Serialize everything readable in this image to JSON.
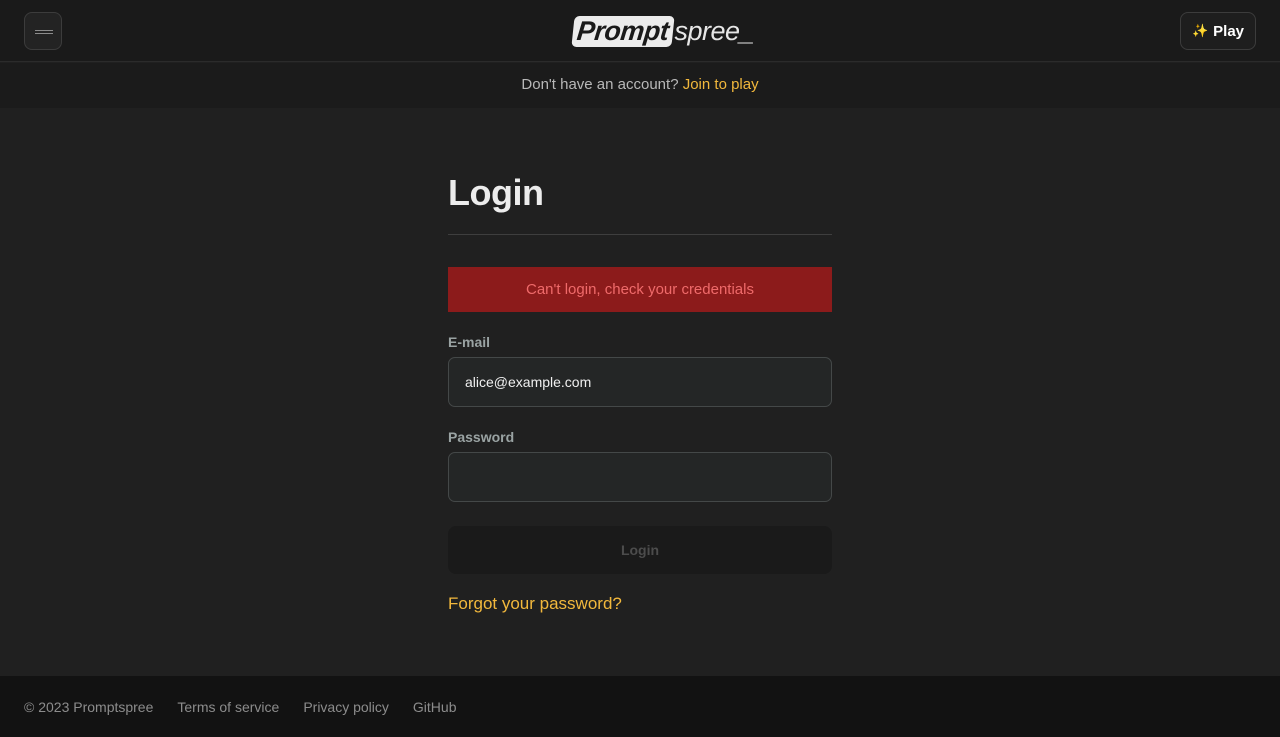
{
  "header": {
    "logo_prompt": "Prompt",
    "logo_rest": "spree_",
    "play_icon": "sparkles-icon",
    "play_label": "Play",
    "menu_icon": "hamburger-menu-icon"
  },
  "subbar": {
    "text": "Don't have an account?",
    "link": "Join to play"
  },
  "login": {
    "title": "Login",
    "error": "Can't login, check your credentials",
    "email_label": "E-mail",
    "email_value": "alice@example.com",
    "password_label": "Password",
    "password_value": "",
    "submit_label": "Login",
    "forgot_link": "Forgot your password?"
  },
  "footer": {
    "copyright": "© 2023 Promptspree",
    "links": [
      "Terms of service",
      "Privacy policy",
      "GitHub"
    ]
  },
  "colors": {
    "accent": "#f2b83c",
    "error_bg": "#8c1b1b",
    "error_text": "#ef6a6a",
    "background": "#202020"
  }
}
